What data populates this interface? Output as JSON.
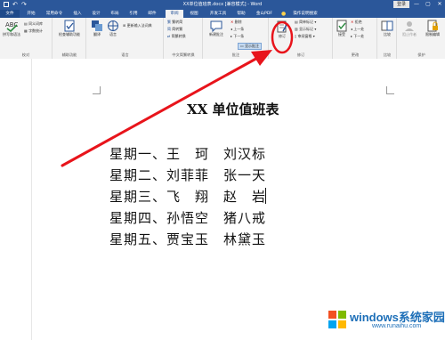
{
  "window": {
    "title": "XX单位值班表.docx [兼容模式] - Word",
    "signin": "登录",
    "minimize": "—",
    "restore": "▢",
    "close": "✕"
  },
  "tabs": [
    {
      "label": "文件"
    },
    {
      "label": "开始"
    },
    {
      "label": "常用命令"
    },
    {
      "label": "插入"
    },
    {
      "label": "设计"
    },
    {
      "label": "布局"
    },
    {
      "label": "引用"
    },
    {
      "label": "邮件"
    },
    {
      "label": "审阅"
    },
    {
      "label": "视图"
    },
    {
      "label": "开发工具"
    },
    {
      "label": "帮助"
    },
    {
      "label": "金山PDF"
    },
    {
      "label": "操作说明搜索"
    }
  ],
  "ribbon": {
    "proofing": {
      "spelling": "拼写和语法",
      "thesaurus": "同义词库",
      "wordcount": "字数统计",
      "label": "校对"
    },
    "accessibility": {
      "check": "检查辅助功能",
      "label": "辅助功能"
    },
    "language": {
      "translate": "翻译",
      "language": "语言",
      "update_ime": "更新输入法词典",
      "label": "语言"
    },
    "chinese": {
      "trad_to_simp": "繁转简",
      "simp_to_trad": "简转繁",
      "convert": "简繁转换",
      "label": "中文简繁转换"
    },
    "comments": {
      "new": "新建批注",
      "delete": "删除",
      "prev": "上一条",
      "next": "下一条",
      "show": "显示批注",
      "label": "批注"
    },
    "tracking": {
      "track": "修订",
      "simple_markup": "简单标记",
      "show_markup": "显示标记",
      "review_pane": "审阅窗格",
      "label": "修订"
    },
    "changes": {
      "accept": "接受",
      "reject": "拒绝",
      "prev": "上一处",
      "next": "下一处",
      "label": "更改"
    },
    "compare": {
      "compare": "比较",
      "label": "比较"
    },
    "protect": {
      "block_authors": "阻止作者",
      "restrict": "限制编辑",
      "label": "保护"
    }
  },
  "document": {
    "title": "XX 单位值班表",
    "lines": [
      "星期一、王　珂　刘汉标",
      "星期二、刘菲菲　张一天",
      "星期三、飞　翔　赵　岩",
      "星期四、孙悟空　猪八戒",
      "星期五、贾宝玉　林黛玉"
    ]
  },
  "watermark": {
    "text": "windows系统家园",
    "url": "www.runaihu.com"
  },
  "colors": {
    "brand": "#2b579a",
    "annotation": "#e8141b"
  }
}
